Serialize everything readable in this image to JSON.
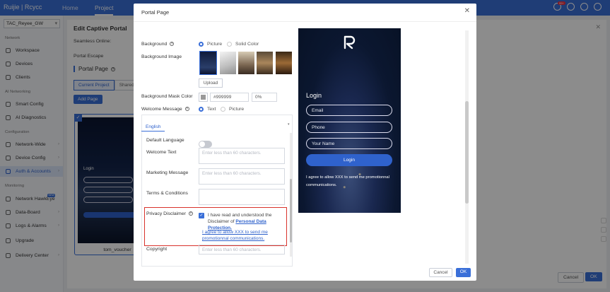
{
  "topbar": {
    "logo_brand": "Ruijie",
    "logo_suffix": "| Rcycc",
    "nav": [
      "Home",
      "Project"
    ],
    "badge": "99+"
  },
  "sidebar": {
    "site": "TAC_Reyee_GW",
    "sections": {
      "network": "Network",
      "ai_networking": "AI Networking",
      "configuration": "Configuration",
      "monitoring": "Monitoring"
    },
    "items": {
      "workspace": "Workspace",
      "devices": "Devices",
      "clients": "Clients",
      "smart_config": "Smart Config",
      "ai_diagnostics": "AI Diagnostics",
      "network_wide": "Network-Wide",
      "device_config": "Device Config",
      "auth_accounts": "Auth & Accounts",
      "network_hawkeye": "Network HawkEye",
      "new_tag": "NEW",
      "data_board": "Data-Board",
      "logs_alarms": "Logs & Alarms",
      "upgrade": "Upgrade",
      "delivery_center": "Delivery Center"
    }
  },
  "main": {
    "title": "Edit Captive Portal",
    "seamless_online": "Seamless Online:",
    "portal_escape": "Portal Escape",
    "portal_page": "Portal Page",
    "tabs": [
      "Current Project",
      "Shared"
    ],
    "add_page": "Add Page",
    "thumb_label": "tom_voucher",
    "thumb_login": "Login",
    "cancel": "Cancel",
    "ok": "OK"
  },
  "modal": {
    "title": "Portal Page",
    "background_label": "Background",
    "background_options": {
      "picture": "Picture",
      "solid": "Solid Color"
    },
    "background_image_label": "Background Image",
    "upload": "Upload",
    "mask_color_label": "Background Mask Color",
    "mask_color_value": "#999999",
    "mask_opacity": "0%",
    "welcome_message_label": "Welcome Message",
    "welcome_options": {
      "text": "Text",
      "picture": "Picture"
    },
    "language_tab": "English",
    "default_language_label": "Default Language",
    "welcome_text_label": "Welcome Text",
    "marketing_message_label": "Marketing Message",
    "terms_label": "Terms & Conditions",
    "privacy_label": "Privacy Disclaimer",
    "copyright_label": "Copyright",
    "placeholder_60": "Enter less than 60 characters.",
    "privacy_text_prefix": "I have read and understood the Disclaimer of ",
    "privacy_link": "Personal Data Protection.",
    "agree_link": "I agree to allow XXX to send me promotionnal communications.",
    "cancel": "Cancel",
    "ok": "OK"
  },
  "preview": {
    "login": "Login",
    "email": "Email",
    "phone": "Phone",
    "your_name": "Your Name",
    "login_button": "Login",
    "agree": "I agree to allow XXX to send me promotionnal communications."
  }
}
